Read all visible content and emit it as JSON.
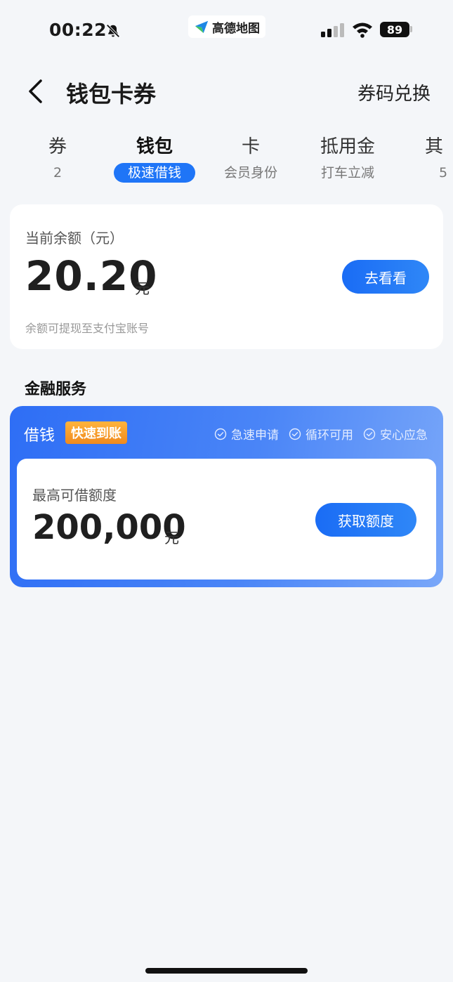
{
  "status_bar": {
    "time": "00:22",
    "app_name": "高德地图",
    "battery": "89"
  },
  "nav": {
    "title": "钱包卡券",
    "redeem": "券码兑换"
  },
  "tabs": [
    {
      "label": "券",
      "sub": "2"
    },
    {
      "label": "钱包",
      "sub": "极速借钱",
      "active": true
    },
    {
      "label": "卡",
      "sub": "会员身份"
    },
    {
      "label": "抵用金",
      "sub": "打车立减"
    },
    {
      "label": "其",
      "sub": "5"
    }
  ],
  "balance": {
    "label": "当前余额（元）",
    "amount": "20.20",
    "unit": "元",
    "note": "余额可提现至支付宝账号",
    "button": "去看看"
  },
  "finance": {
    "section_title": "金融服务",
    "loan_title": "借钱",
    "badge": "快速到账",
    "features": [
      "急速申请",
      "循环可用",
      "安心应急"
    ],
    "limit_label": "最高可借额度",
    "limit_amount": "200,000",
    "limit_unit": "元",
    "button": "获取额度"
  },
  "colors": {
    "accent": "#1f75f7",
    "badge_orange": "#f59a2a",
    "background": "#f4f6f9"
  }
}
